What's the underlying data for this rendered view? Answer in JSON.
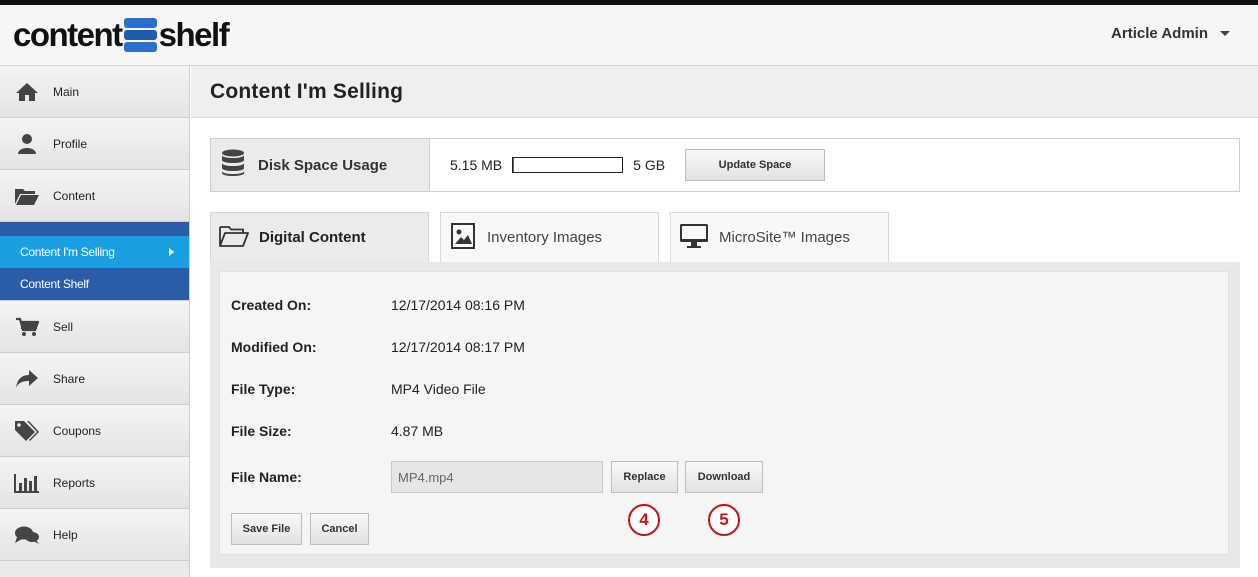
{
  "brand": {
    "logo_left": "content",
    "logo_right": "shelf"
  },
  "header": {
    "user_name": "Article Admin"
  },
  "sidebar": {
    "items": [
      {
        "label": "Main",
        "icon": "home-icon"
      },
      {
        "label": "Profile",
        "icon": "user-icon"
      },
      {
        "label": "Content",
        "icon": "folder-open-icon"
      }
    ],
    "subitems": [
      {
        "label": "Content I'm Selling",
        "active": true
      },
      {
        "label": "Content Shelf",
        "active": false
      }
    ],
    "items_after": [
      {
        "label": "Sell",
        "icon": "cart-icon"
      },
      {
        "label": "Share",
        "icon": "share-arrow-icon"
      },
      {
        "label": "Coupons",
        "icon": "tags-icon"
      },
      {
        "label": "Reports",
        "icon": "bar-chart-icon"
      },
      {
        "label": "Help",
        "icon": "chat-bubbles-icon"
      }
    ]
  },
  "page": {
    "title": "Content I'm Selling"
  },
  "disk": {
    "label": "Disk Space Usage",
    "used": "5.15 MB",
    "total": "5 GB",
    "used_fraction": 0.001,
    "button": "Update Space"
  },
  "tabs": [
    {
      "label": "Digital Content",
      "icon": "folder-open-icon",
      "active": true
    },
    {
      "label": "Inventory Images",
      "icon": "image-icon",
      "active": false
    },
    {
      "label": "MicroSite™ Images",
      "icon": "monitor-icon",
      "active": false
    }
  ],
  "details": {
    "created_label": "Created On:",
    "created_value": "12/17/2014 08:16 PM",
    "modified_label": "Modified On:",
    "modified_value": "12/17/2014 08:17 PM",
    "type_label": "File Type:",
    "type_value": "MP4 Video File",
    "size_label": "File Size:",
    "size_value": "4.87 MB",
    "name_label": "File Name:",
    "name_value": "MP4.mp4"
  },
  "buttons": {
    "replace": "Replace",
    "download": "Download",
    "save": "Save File",
    "cancel": "Cancel"
  },
  "markers": {
    "replace": "4",
    "download": "5"
  },
  "colors": {
    "accent_blue": "#2a5ca8",
    "active_blue": "#1aa0e0",
    "marker_red": "#c0141c"
  }
}
